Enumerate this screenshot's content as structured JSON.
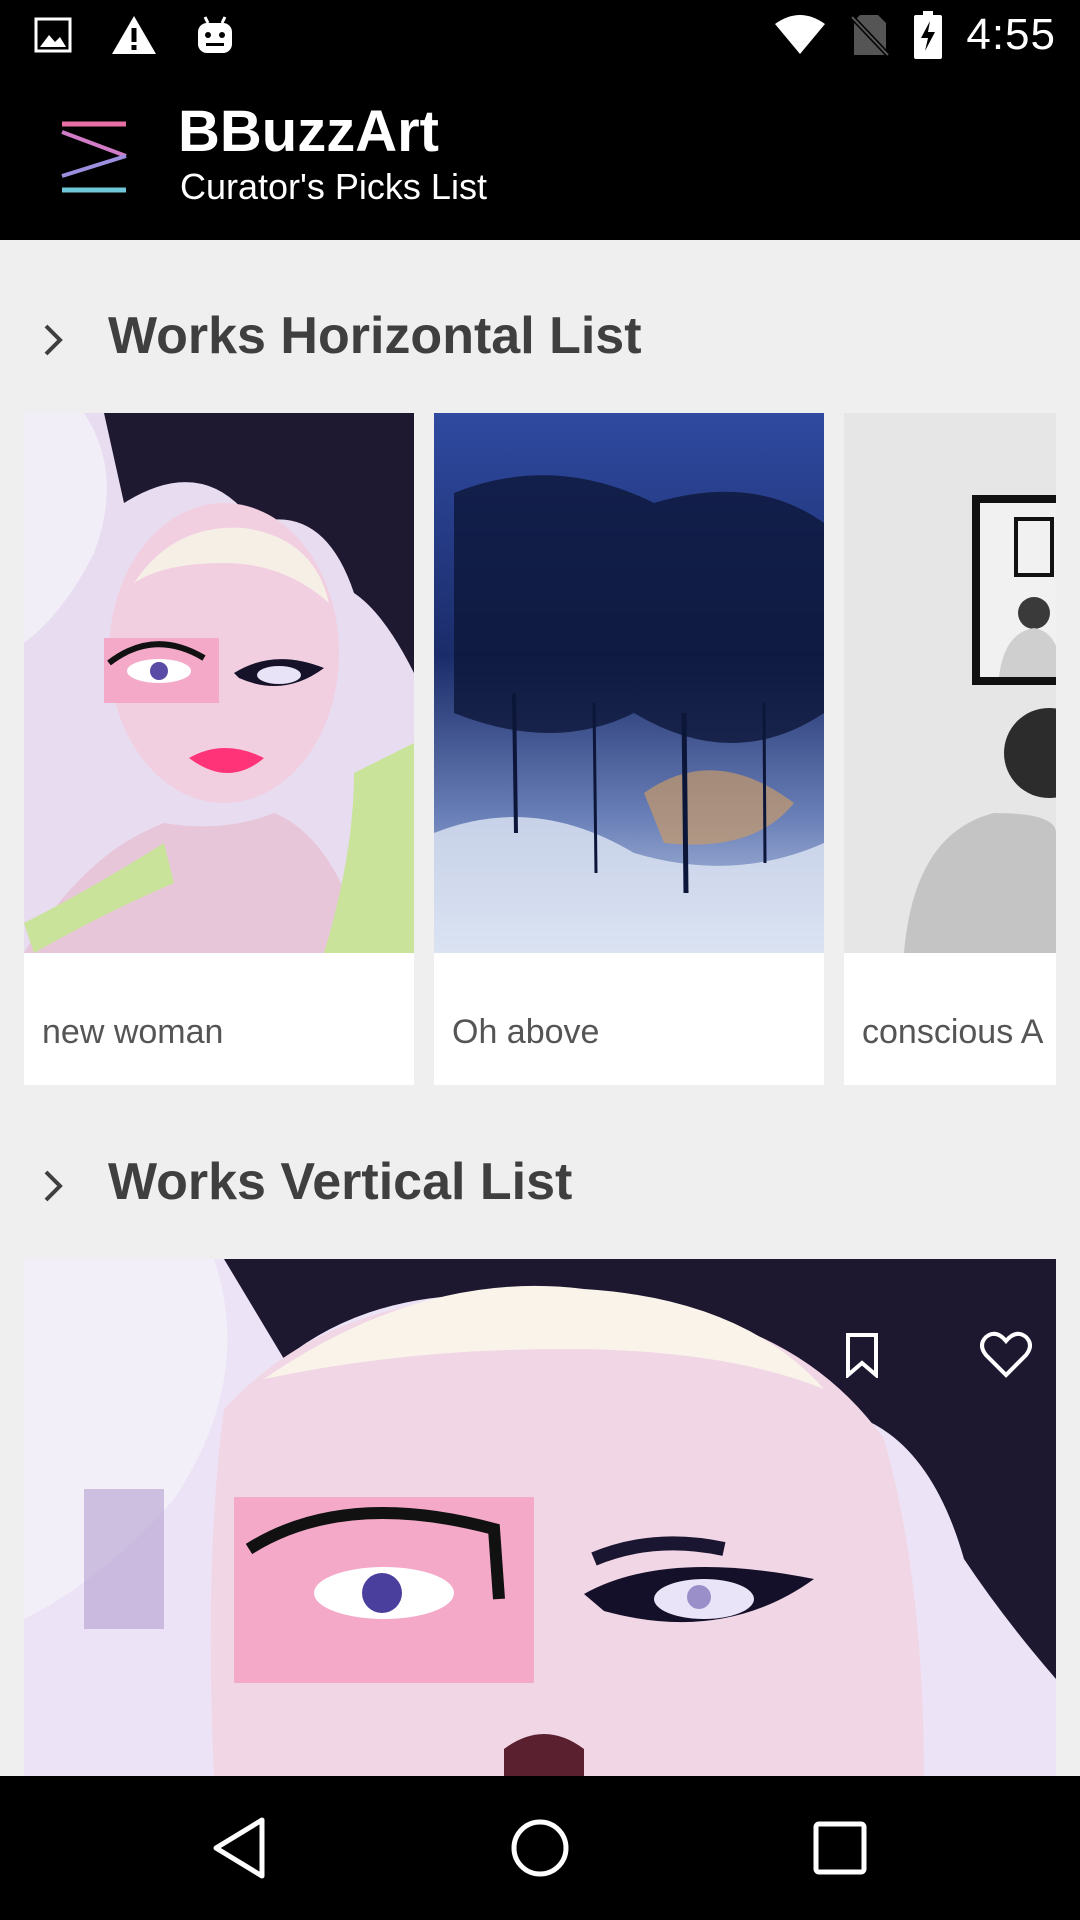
{
  "status_bar": {
    "time": "4:55",
    "left_icons": [
      "image-icon",
      "warning-icon",
      "android-icon"
    ],
    "right_icons": [
      "wifi-icon",
      "no-sim-icon",
      "battery-charging-icon"
    ]
  },
  "toolbar": {
    "title": "BBuzzArt",
    "subtitle": "Curator's Picks List",
    "logo_colors": [
      "#e86fa5",
      "#c77ad8",
      "#8f8fe0",
      "#6fc8d8"
    ]
  },
  "sections": {
    "horizontal": {
      "title": "Works Horizontal List",
      "items": [
        {
          "title": "new woman"
        },
        {
          "title": "Oh above"
        },
        {
          "title": "conscious A"
        }
      ]
    },
    "vertical": {
      "title": "Works Vertical List",
      "actions": [
        "bookmark-icon",
        "heart-icon"
      ]
    }
  },
  "nav_bar": {
    "buttons": [
      "back-icon",
      "home-icon",
      "recents-icon"
    ]
  },
  "colors": {
    "bars": "#000000",
    "background": "#efefef",
    "section_title": "#3f3f3f",
    "card_text": "#555555"
  }
}
